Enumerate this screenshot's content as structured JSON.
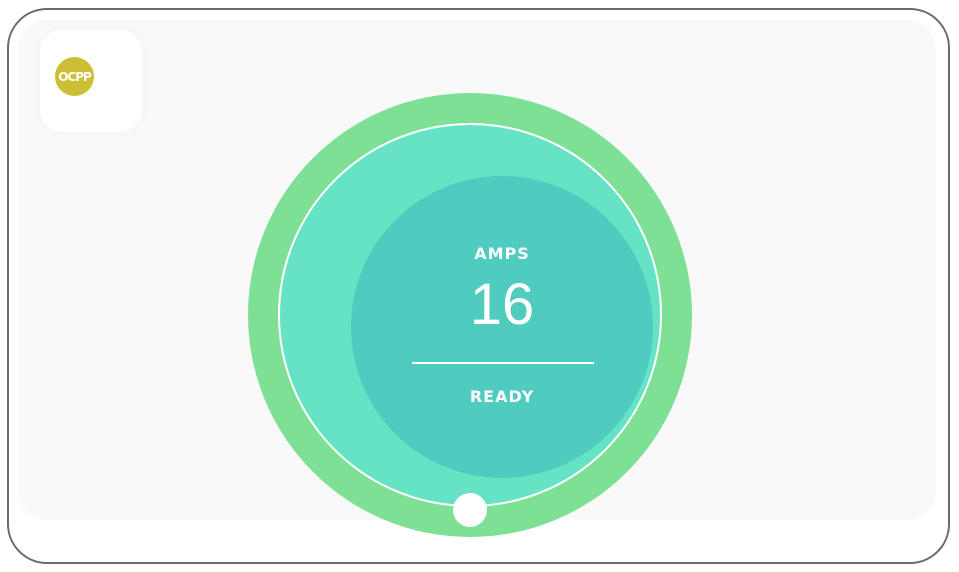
{
  "app": {
    "logo_text": "OCPP",
    "logo_color": "#cdbf35"
  },
  "gauge": {
    "label": "AMPS",
    "value": "16",
    "status": "READY",
    "colors": {
      "outer": "#7de094",
      "ring": "#66e3c4",
      "inner": "#4fcbbf"
    }
  }
}
